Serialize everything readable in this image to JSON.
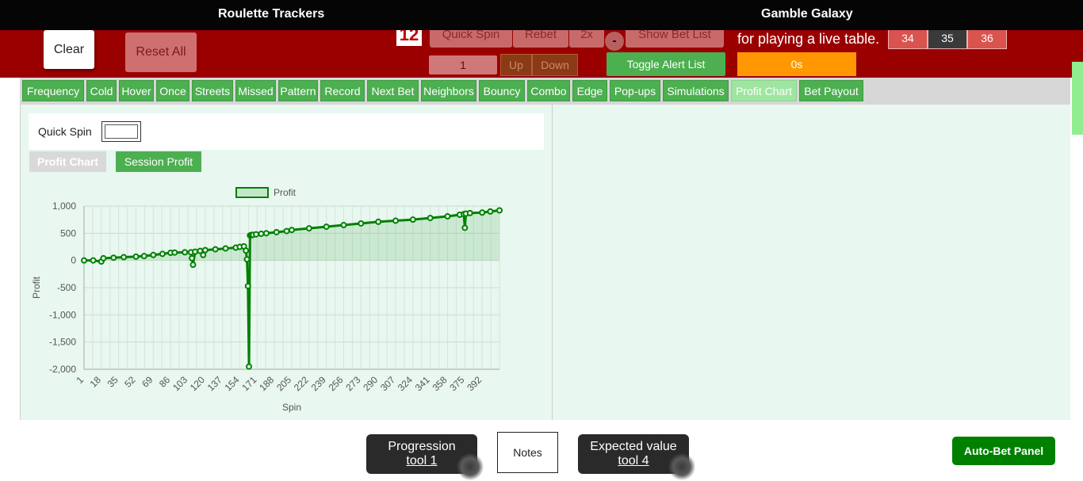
{
  "header": {
    "left_title": "Roulette Trackers",
    "right_title": "Gamble Galaxy"
  },
  "controls": {
    "clear": "Clear",
    "reset_all": "Reset All",
    "last_number": "12",
    "quick_spin": "Quick Spin",
    "rebet": "Rebet",
    "double": "2x",
    "minus": "-",
    "show_bet_list": "Show Bet List",
    "spin_count": "1",
    "up": "Up",
    "down": "Down",
    "toggle_alert_list": "Toggle Alert List",
    "live_table_text": "for playing a live table.",
    "timer": "0s",
    "numbers": [
      {
        "label": "34",
        "color": "#d9534f"
      },
      {
        "label": "35",
        "color": "#3a3a3a"
      },
      {
        "label": "36",
        "color": "#d9534f"
      }
    ]
  },
  "tabs": [
    {
      "label": "Frequency",
      "active": false
    },
    {
      "label": "Cold",
      "active": false
    },
    {
      "label": "Hover",
      "active": false
    },
    {
      "label": "Once",
      "active": false
    },
    {
      "label": "Streets",
      "active": false
    },
    {
      "label": "Missed",
      "active": false
    },
    {
      "label": "Pattern",
      "active": false
    },
    {
      "label": "Record",
      "active": false
    },
    {
      "label": "Next Bet",
      "active": false
    },
    {
      "label": "Neighbors",
      "active": false
    },
    {
      "label": "Bouncy",
      "active": false
    },
    {
      "label": "Combo",
      "active": false
    },
    {
      "label": "Edge",
      "active": false
    },
    {
      "label": "Pop-ups",
      "active": false
    },
    {
      "label": "Simulations",
      "active": false
    },
    {
      "label": "Profit Chart",
      "active": true
    },
    {
      "label": "Bet Payout",
      "active": false
    }
  ],
  "panel": {
    "quick_spin_label": "Quick Spin",
    "profit_chart_button": "Profit Chart",
    "session_profit_button": "Session Profit"
  },
  "chart_data": {
    "type": "line",
    "title": "",
    "xlabel": "Spin",
    "ylabel": "Profit",
    "legend": [
      "Profit"
    ],
    "legend_position": "top-center",
    "grid": true,
    "color": "#008000",
    "fill": "rgba(0,128,0,0.12)",
    "xlim": [
      1,
      409
    ],
    "ylim": [
      -2000,
      1000
    ],
    "y_ticks": [
      "1,000",
      "500",
      "0",
      "-500",
      "-1,000",
      "-1,500",
      "-2,000"
    ],
    "y_tick_values": [
      1000,
      500,
      0,
      -500,
      -1000,
      -1500,
      -2000
    ],
    "x_ticks": [
      "1",
      "18",
      "35",
      "52",
      "69",
      "86",
      "103",
      "120",
      "137",
      "154",
      "171",
      "188",
      "205",
      "222",
      "239",
      "256",
      "273",
      "290",
      "307",
      "324",
      "341",
      "358",
      "375",
      "392"
    ],
    "x_tick_values": [
      1,
      18,
      35,
      52,
      69,
      86,
      103,
      120,
      137,
      154,
      171,
      188,
      205,
      222,
      239,
      256,
      273,
      290,
      307,
      324,
      341,
      358,
      375,
      392
    ],
    "series": [
      {
        "name": "Profit",
        "x": [
          1,
          10,
          18,
          20,
          30,
          40,
          52,
          60,
          69,
          78,
          86,
          90,
          100,
          106,
          107,
          108,
          110,
          115,
          118,
          120,
          130,
          140,
          150,
          154,
          158,
          160,
          161,
          162,
          163,
          164,
          165,
          166,
          167,
          170,
          175,
          180,
          190,
          200,
          205,
          222,
          239,
          256,
          273,
          290,
          307,
          324,
          341,
          358,
          370,
          374,
          375,
          376,
          380,
          392,
          400,
          409
        ],
        "y": [
          0,
          0,
          -20,
          40,
          50,
          60,
          70,
          80,
          100,
          120,
          140,
          145,
          150,
          150,
          40,
          -80,
          160,
          175,
          100,
          190,
          205,
          220,
          235,
          250,
          260,
          180,
          20,
          -470,
          -1950,
          460,
          465,
          470,
          470,
          480,
          490,
          500,
          520,
          540,
          560,
          590,
          620,
          650,
          680,
          710,
          730,
          750,
          780,
          810,
          840,
          850,
          600,
          860,
          870,
          880,
          900,
          920
        ]
      }
    ]
  },
  "bottom": {
    "progression_line1": "Progression",
    "progression_line2": "tool 1",
    "notes": "Notes",
    "ev_line1": "Expected value",
    "ev_line2": "tool 4",
    "auto_bet": "Auto-Bet Panel"
  }
}
